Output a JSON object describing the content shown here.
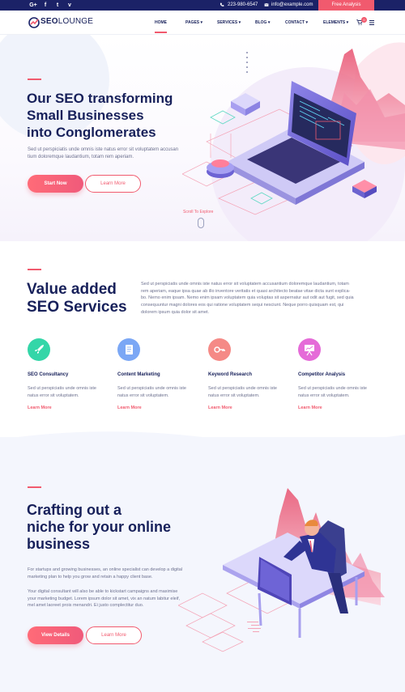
{
  "topbar": {
    "social": [
      "G+",
      "f",
      "t",
      "v"
    ],
    "phone": "223-980-6547",
    "email": "info@example.com",
    "cta": "Free Analysis",
    "colors": {
      "bar": "#1b2267",
      "accent": "#f15a6e"
    }
  },
  "nav": {
    "logo_seo": "SEO",
    "logo_lounge": "LOUNGE",
    "items": [
      "HOME",
      "PAGES",
      "SERVICES",
      "BLOG",
      "CONTACT",
      "ELEMENTS"
    ],
    "active": "HOME",
    "cart_count": "0"
  },
  "hero": {
    "title_line1": "Our SEO transforming",
    "title_line2": "Small Businesses",
    "title_line3": "into Conglomerates",
    "text_line1": "Sed ut perspiciatis unde omnis iste natus error sit voluptatem accusan",
    "text_line2": "tium doloremque laudantium, totam rem aperiam.",
    "btn_primary": "Start Now",
    "btn_secondary": "Learn More",
    "scroll": "Scroll To Explore"
  },
  "services": {
    "title_line1": "Value added",
    "title_line2": "SEO Services",
    "intro_lines": [
      "Sed ut perspiciatis unde omnis iste natus error sit voluptatem accusantium doloremque laudantium, totam",
      "rem aperiam, eaque ipsa quae ab illo inventore veritatis et quasi architecto beatae vitae dicta sunt explica-",
      "bo. Nemo enim ipsam. Nemo enim ipsam voluptatem quia voluptas sit aspernatur aut odit aut fugit, sed quia",
      "consequuntur magni dolores eos qui ratione voluptatem sequi nesciunt. Neque porro quisquam est, qui",
      "dolorem ipsum quia dolor sit amet."
    ],
    "items": [
      {
        "title": "SEO Consultancy",
        "line1": "Sed ut perspiciatis unde omnis iste",
        "line2": "natus error sit voluptatem.",
        "link": "Learn More",
        "icon": "rocket-icon",
        "color": "#34d6a8"
      },
      {
        "title": "Content Marketing",
        "line1": "Sed ut perspiciatis unde omnis iste",
        "line2": "natus error sit voluptatem.",
        "link": "Learn More",
        "icon": "document-icon",
        "color": "#7ba7f5"
      },
      {
        "title": "Keyword Research",
        "line1": "Sed ut perspiciatis unde omnis iste",
        "line2": "natus error sit voluptatem.",
        "link": "Learn More",
        "icon": "key-icon",
        "color": "#f58a86"
      },
      {
        "title": "Competitor Analysis",
        "line1": "Sed ut perspiciatis unde omnis iste",
        "line2": "natus error sit voluptatem.",
        "link": "Learn More",
        "icon": "presentation-icon",
        "color": "#e56bd8"
      }
    ]
  },
  "niche": {
    "title_line1": "Crafting out a",
    "title_line2": "niche for your online",
    "title_line3": "business",
    "p1_line1": "For startups and growing businesses, an online specialist can develop a digital",
    "p1_line2": "marketing plan to help you grow and retain a happy client base.",
    "p2_line1": "Your digital consultant will also be able to kickstart campaigns and maximise",
    "p2_line2": "your marketing budget. Lorem ipsum dolor sit amet, vix an natum labitur eleif,",
    "p2_line3": "mel amet laoreet prois menandri. Ei justo complectitur duo.",
    "btn_primary": "View Details",
    "btn_secondary": "Learn More"
  }
}
